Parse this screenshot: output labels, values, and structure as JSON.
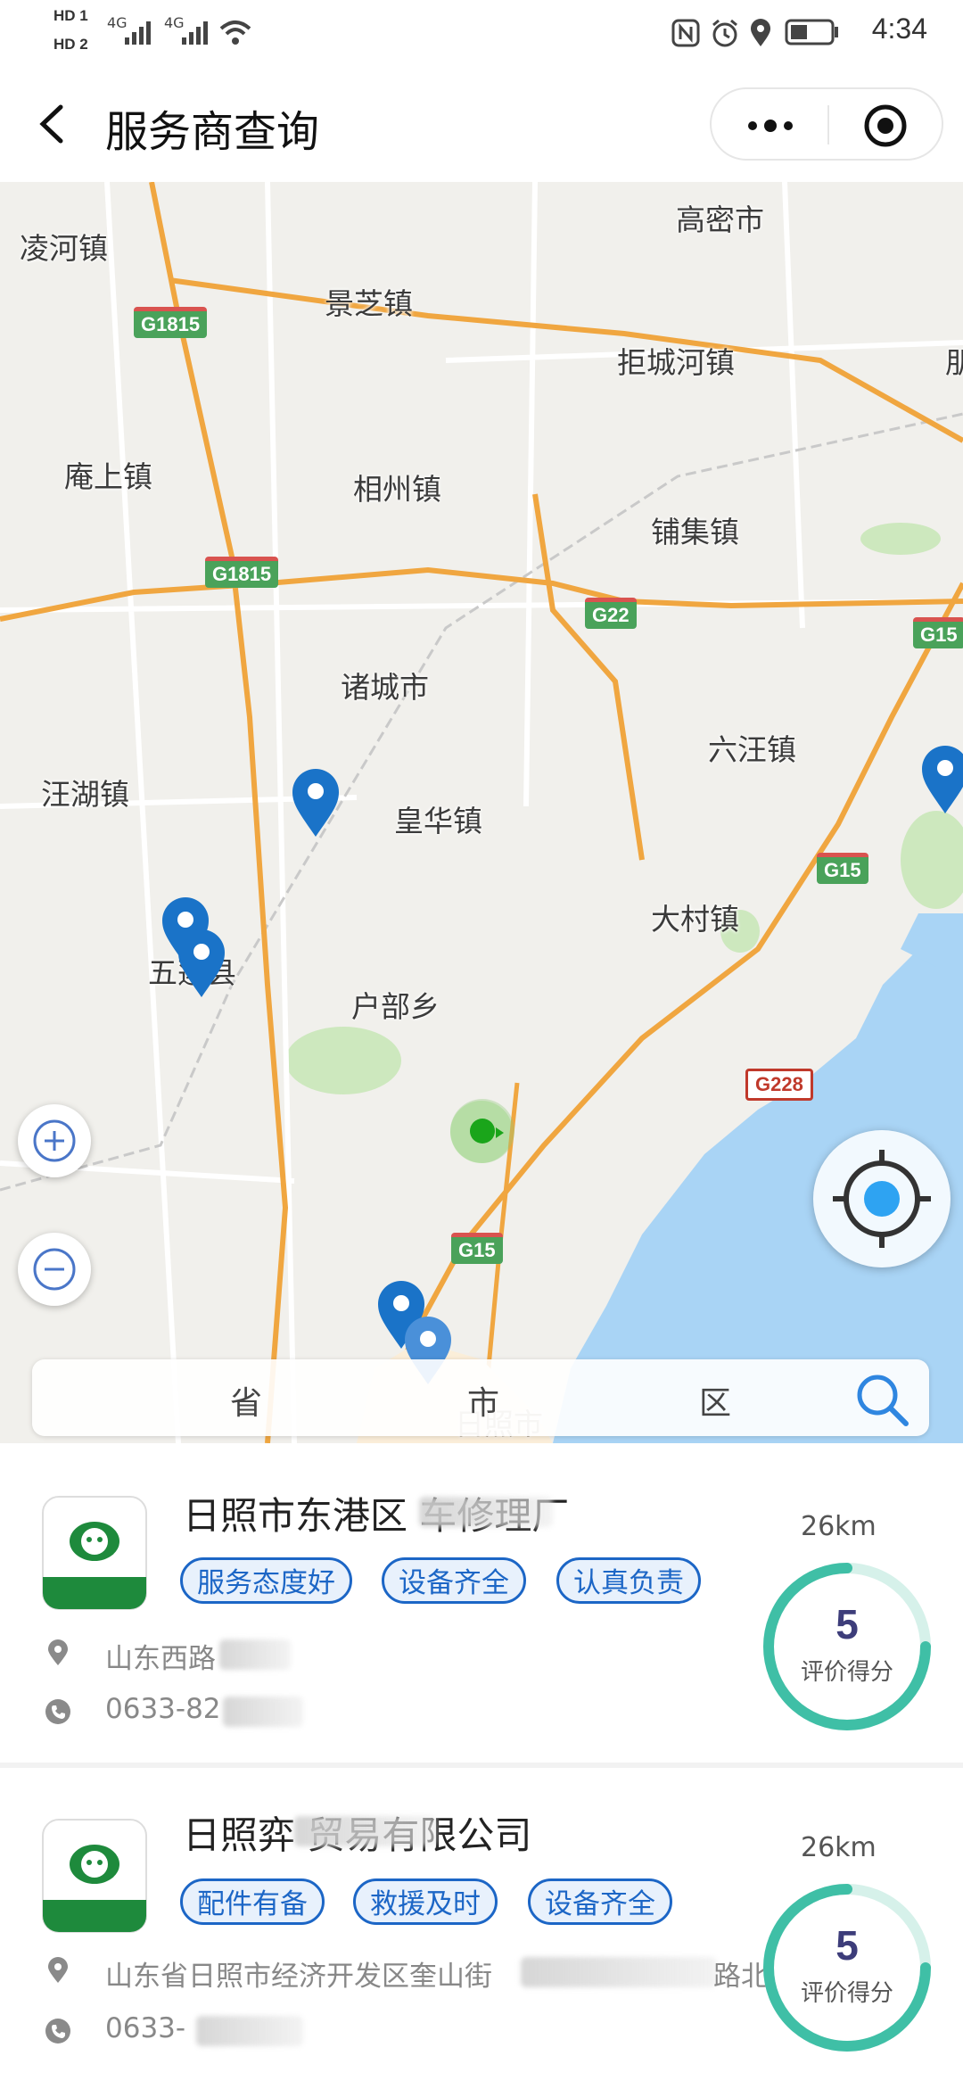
{
  "status_bar": {
    "hd1": "HD 1",
    "hd2": "HD 2",
    "signal1": "4G",
    "signal2": "4G",
    "time": "4:34"
  },
  "nav": {
    "title": "服务商查询",
    "back_icon": "chevron-left-icon",
    "more_icon": "more-dots-icon",
    "close_icon": "target-close-icon"
  },
  "map": {
    "places": [
      "凌河镇",
      "高密市",
      "景芝镇",
      "拒城河镇",
      "庵上镇",
      "相州镇",
      "铺集镇",
      "诸城市",
      "六汪镇",
      "汪湖镇",
      "皇华镇",
      "大村镇",
      "五莲县",
      "户部乡",
      "日照市",
      "朋"
    ],
    "highways": [
      "G1815",
      "G1815",
      "G22",
      "G15",
      "G15",
      "G228",
      "G15"
    ],
    "pin_color": "#1a73c8",
    "user_dot_color": "#1aa51a",
    "sea_color": "#a9d4f5"
  },
  "filter": {
    "province": "省",
    "city": "市",
    "district": "区",
    "search_icon": "search-icon"
  },
  "providers": [
    {
      "name": "日照市东港区  车修理厂",
      "tags": [
        "服务态度好",
        "设备齐全",
        "认真负责"
      ],
      "address": "山东西路",
      "phone": "0633-82",
      "distance": "26km",
      "score": "5",
      "score_label": "评价得分"
    },
    {
      "name": "日照弈  贸易有限公司",
      "tags": [
        "配件有备",
        "救援及时",
        "设备齐全"
      ],
      "address": "山东省日照市经济开发区奎山街",
      "address_tail": "路北",
      "phone": "0633-",
      "distance": "26km",
      "score": "5",
      "score_label": "评价得分"
    }
  ],
  "colors": {
    "tag_blue": "#1c66c6",
    "ring_teal": "#3fbfa6"
  }
}
